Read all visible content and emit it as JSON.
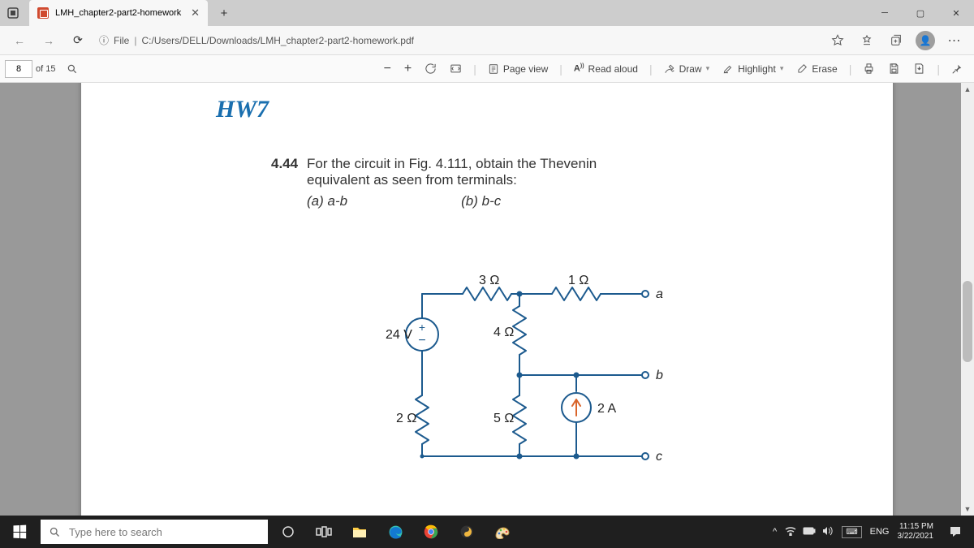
{
  "browser": {
    "tab_title": "LMH_chapter2-part2-homework",
    "url_prefix": "File",
    "url_path": "C:/Users/DELL/Downloads/LMH_chapter2-part2-homework.pdf"
  },
  "pdf_toolbar": {
    "page_current": "8",
    "page_total": "of 15",
    "page_view": "Page view",
    "read_aloud": "Read aloud",
    "draw": "Draw",
    "highlight": "Highlight",
    "erase": "Erase"
  },
  "document": {
    "hw_title": "HW7",
    "problem_number": "4.44",
    "problem_text_l1": "For the circuit in Fig. 4.111, obtain the Thevenin",
    "problem_text_l2": "equivalent as seen from terminals:",
    "part_a": "(a) a-b",
    "part_b": "(b) b-c",
    "circuit": {
      "v_source": "24 V",
      "r1": "3 Ω",
      "r2": "1 Ω",
      "r3": "4 Ω",
      "r4": "2 Ω",
      "r5": "5 Ω",
      "i_source": "2 A",
      "term_a": "a",
      "term_b": "b",
      "term_c": "c"
    }
  },
  "taskbar": {
    "search_placeholder": "Type here to search",
    "lang": "ENG",
    "time": "11:15 PM",
    "date": "3/22/2021"
  }
}
